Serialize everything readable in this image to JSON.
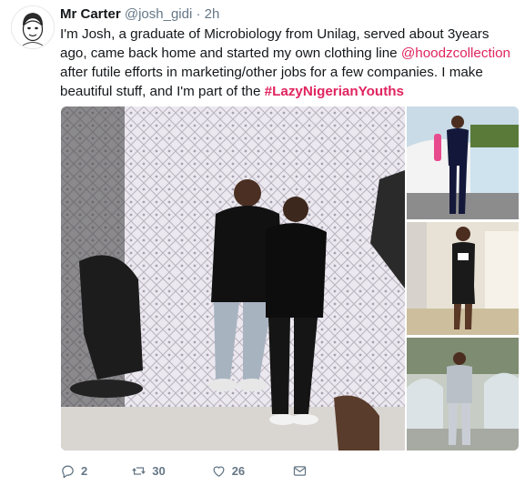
{
  "tweet": {
    "author_name": "Mr Carter",
    "author_handle": "@josh_gidi",
    "separator": "·",
    "timestamp": "2h",
    "text_part1": "I'm Josh, a graduate of Microbiology from Unilag, served about 3years ago, came back home and started my own clothing line ",
    "mention": "@hoodzcollection",
    "text_part2": " after futile efforts in marketing/other jobs for a few companies. I make beautiful stuff, and I'm part of the ",
    "hashtag": "#LazyNigerianYouths"
  },
  "media": {
    "photo_count": 4
  },
  "actions": {
    "replies": "2",
    "retweets": "30",
    "likes": "26"
  },
  "colors": {
    "accent": "#e0245e",
    "muted": "#657786",
    "text": "#14171a"
  },
  "icons": {
    "reply": "reply-icon",
    "retweet": "retweet-icon",
    "like": "heart-icon",
    "message": "direct-message-icon"
  }
}
